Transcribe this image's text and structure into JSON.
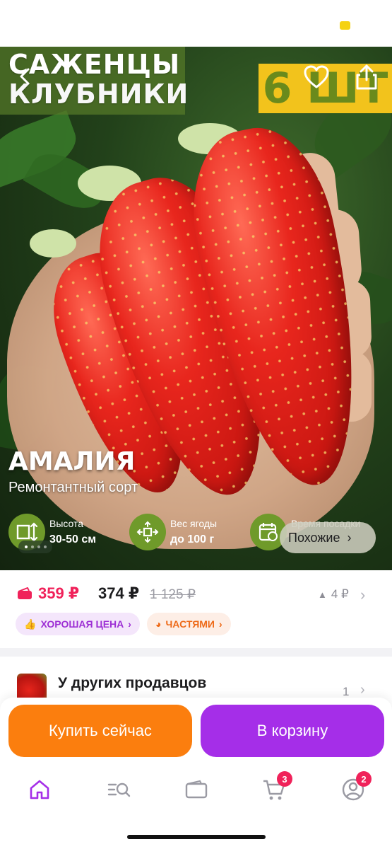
{
  "hero": {
    "title_line1": "САЖЕНЦЫ",
    "title_line2": "КЛУБНИКИ",
    "badge": "6 ШТ",
    "variety": "АМАЛИЯ",
    "variety_subtitle": "Ремонтантный сорт",
    "features": [
      {
        "icon": "height-icon",
        "label": "Высота",
        "value": "30-50 см"
      },
      {
        "icon": "berry-weight-icon",
        "label": "Вес ягоды",
        "value": "до 100 г"
      },
      {
        "icon": "calendar-icon",
        "label": "Время посадки",
        "value": ""
      }
    ],
    "gallery_dots": 4,
    "gallery_active": 0,
    "similar_label": "Похожие"
  },
  "price": {
    "main": "359 ₽",
    "alt": "374 ₽",
    "old": "1 125 ₽",
    "drop": "4 ₽",
    "tags": [
      {
        "label": "ХОРОШАЯ ЦЕНА",
        "color": "#9d2fd4"
      },
      {
        "label": "ЧАСТЯМИ",
        "color": "#ee6a18"
      }
    ]
  },
  "sellers": {
    "title": "У других продавцов",
    "count": "1"
  },
  "actions": {
    "buy_label": "Купить сейчас",
    "cart_label": "В корзину"
  },
  "tabbar": {
    "items": [
      {
        "icon": "home-icon",
        "badge": ""
      },
      {
        "icon": "catalog-search-icon",
        "badge": ""
      },
      {
        "icon": "wallet-icon",
        "badge": ""
      },
      {
        "icon": "cart-icon",
        "badge": "3"
      },
      {
        "icon": "profile-icon",
        "badge": "2"
      }
    ],
    "active_color": "#a52ee8"
  }
}
